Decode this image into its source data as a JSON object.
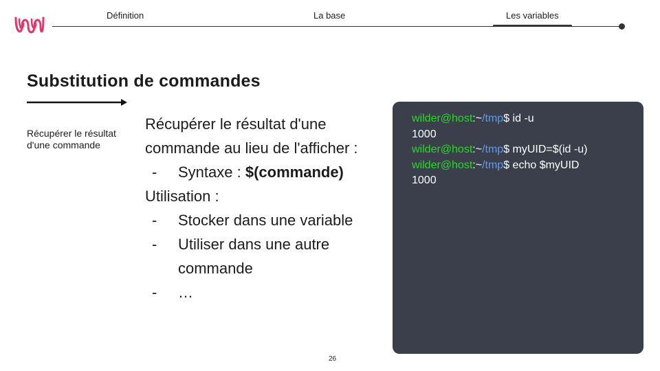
{
  "nav": {
    "items": [
      "Définition",
      "La base",
      "Les variables"
    ],
    "active_index": 2
  },
  "slide": {
    "title": "Substitution de commandes",
    "side_note": "Récupérer le résultat d'une commande",
    "body": {
      "line1": "Récupérer le résultat d'une",
      "line2": "commande  au lieu de l'afficher :",
      "bullet_marker": "-",
      "syntax_label": "Syntaxe : ",
      "syntax_value": "$(commande)",
      "usage_heading": "Utilisation :",
      "usage_items": [
        "Stocker dans une variable",
        "Utiliser dans une autre",
        "commande",
        "…"
      ]
    }
  },
  "terminal": {
    "lines": [
      {
        "user": "wilder@host",
        "sep": ":",
        "tilde": "~",
        "path": "/tmp",
        "cmd": "$ id -u"
      },
      {
        "output": "1000"
      },
      {
        "user": "wilder@host",
        "sep": ":",
        "tilde": "~",
        "path": "/tmp",
        "cmd": "$ myUID=$(id -u)"
      },
      {
        "user": "wilder@host",
        "sep": ":",
        "tilde": "~",
        "path": "/tmp",
        "cmd": "$ echo $myUID"
      },
      {
        "output": "1000"
      }
    ],
    "colors": {
      "background": "#3a3f4b",
      "user": "#2ad72a",
      "path": "#5b9bf0",
      "text": "#ffffff"
    }
  },
  "footer": {
    "page_number": "26"
  },
  "brand": {
    "logo_color": "#e8336b"
  }
}
